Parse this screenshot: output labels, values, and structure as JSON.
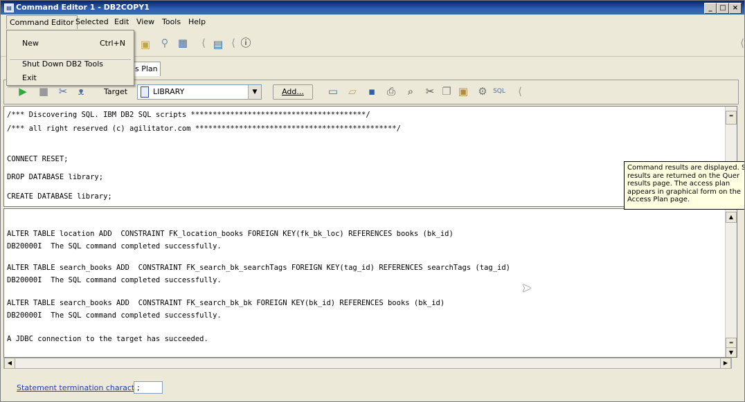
{
  "window": {
    "title": "Command Editor 1 - DB2COPY1",
    "app_icon": "db2-icon"
  },
  "window_controls": {
    "minimize": "_",
    "maximize": "□",
    "close": "×"
  },
  "menubar": {
    "items": [
      "Command Editor",
      "Selected",
      "Edit",
      "View",
      "Tools",
      "Help"
    ]
  },
  "menu_dropdown": {
    "items": [
      {
        "label": "New",
        "shortcut": "Ctrl+N"
      },
      {
        "label": "Shut Down DB2 Tools",
        "shortcut": ""
      },
      {
        "label": "Exit",
        "shortcut": ""
      }
    ]
  },
  "tabs": {
    "visible_partial": "s Plan"
  },
  "toolbar2": {
    "target_label": "Target",
    "target_value": "LIBRARY",
    "add_button": "Add..."
  },
  "input_pane": {
    "lines": [
      "/*** Discovering SQL. IBM DB2 SQL scripts ****************************************/",
      "/*** all right reserved (c) agilitator.com **********************************************/",
      "",
      "CONNECT RESET;",
      "",
      "DROP DATABASE library;",
      "",
      "CREATE DATABASE library;"
    ]
  },
  "output_pane": {
    "lines": [
      "ALTER TABLE location ADD  CONSTRAINT FK_location_books FOREIGN KEY(fk_bk_loc) REFERENCES books (bk_id)",
      "DB20000I  The SQL command completed successfully.",
      "",
      "ALTER TABLE search_books ADD  CONSTRAINT FK_search_bk_searchTags FOREIGN KEY(tag_id) REFERENCES searchTags (tag_id)",
      "DB20000I  The SQL command completed successfully.",
      "",
      "ALTER TABLE search_books ADD  CONSTRAINT FK_search_bk_bk FOREIGN KEY(bk_id) REFERENCES books (bk_id)",
      "DB20000I  The SQL command completed successfully.",
      "",
      "A JDBC connection to the target has succeeded."
    ]
  },
  "tooltip": {
    "text": "Command results are displayed. S\nresults are returned on the Quer\nresults page. The access plan\nappears in graphical form on the\nAccess Plan page."
  },
  "bottom": {
    "termination_label": "Statement termination character",
    "termination_value": ";"
  }
}
